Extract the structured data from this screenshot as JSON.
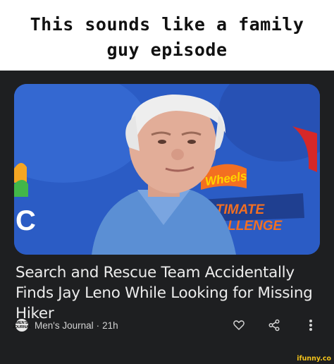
{
  "meme": {
    "caption_line1": "This sounds like a family",
    "caption_line2": "guy episode"
  },
  "article": {
    "headline": "Search and Rescue Team Accidentally Finds Jay Leno While Looking for Missing Hiker",
    "source": "Men's Journal",
    "separator": "·",
    "age": "21h",
    "source_logo_line1": "MEN'S",
    "source_logo_line2": "JOURNAL"
  },
  "thumbnail": {
    "banner_line1": "Wheels",
    "banner_line2": "ULTIMATE",
    "banner_line3": "CHALLENGE",
    "logo_letter": "C"
  },
  "watermark": "ifunny.co",
  "icons": {
    "like": "heart-outline-icon",
    "share": "share-icon",
    "more": "more-vert-icon"
  },
  "colors": {
    "card_bg": "#1e1f21",
    "backdrop_blue": "#2b5cc5",
    "watermark_yellow": "#f2c21a"
  }
}
